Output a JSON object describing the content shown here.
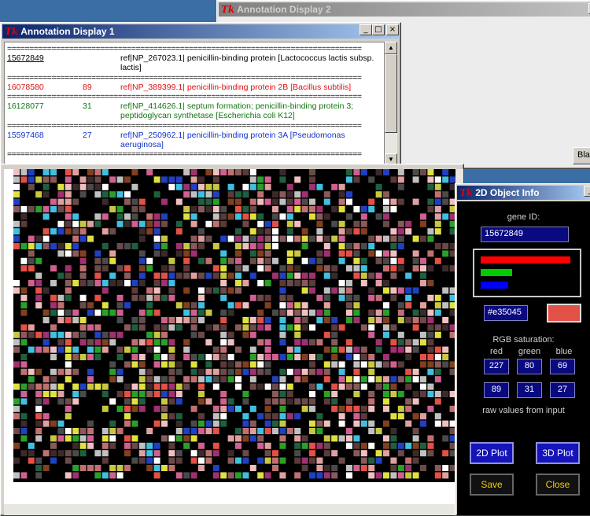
{
  "ann2": {
    "title": "Annotation Display 2",
    "blast_label": "Blas"
  },
  "ann1": {
    "title": "Annotation Display 1",
    "separator": "================================================================================",
    "records": [
      {
        "id": "15672849",
        "score": "",
        "desc": "ref|NP_267023.1| penicillin-binding protein [Lactococcus lactis subsp. lactis]"
      },
      {
        "id": "16078580",
        "score": "89",
        "desc": "ref|NP_389399.1| penicillin-binding protein 2B [Bacillus subtilis]"
      },
      {
        "id": "16128077",
        "score": "31",
        "desc": "ref|NP_414626.1| septum formation; penicillin-binding protein 3; peptidoglycan synthetase [Escherichia coli K12]"
      },
      {
        "id": "15597468",
        "score": "27",
        "desc": "ref|NP_250962.1| penicillin-binding protein 3A [Pseudomonas aeruginosa]"
      }
    ]
  },
  "info": {
    "title": "2D Object Info",
    "gene_label": "gene ID:",
    "gene_id": "15672849",
    "hex": "#e35045",
    "swatch_color": "#e35045",
    "rgb_label": "RGB saturation:",
    "red_label": "red",
    "green_label": "green",
    "blue_label": "blue",
    "rgb": [
      "227",
      "80",
      "69"
    ],
    "raw": [
      "89",
      "31",
      "27"
    ],
    "raw_label": "raw values from input",
    "btn_2d": "2D Plot",
    "btn_3d": "3D Plot",
    "btn_save": "Save",
    "btn_close": "Close",
    "bar_levels": {
      "red": 0.89,
      "green": 0.31,
      "blue": 0.27
    }
  },
  "colors": {
    "red": "#ff0000",
    "green": "#00cc00",
    "blue": "#0000ff"
  },
  "icons": {
    "tk": "tk-icon",
    "minimize": "minimize-icon",
    "maximize": "maximize-icon",
    "close": "close-icon"
  }
}
